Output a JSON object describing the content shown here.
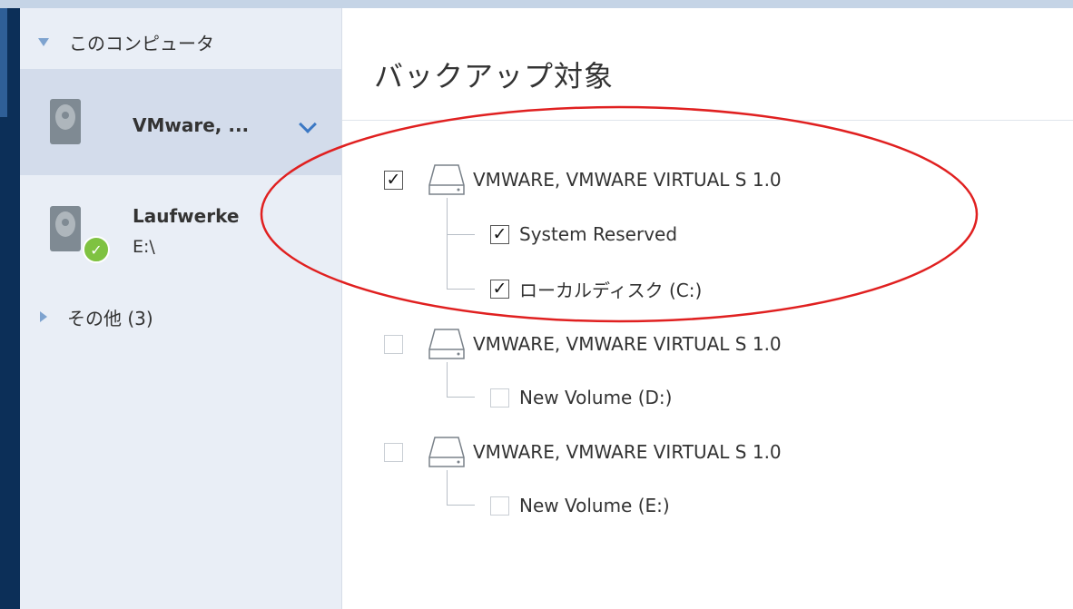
{
  "sidebar": {
    "group_computer": "このコンピュータ",
    "items": [
      {
        "title": "VMware, ...",
        "subtitle": ""
      },
      {
        "title": "Laufwerke",
        "subtitle": "E:\\"
      }
    ],
    "group_other": "その他 (3)"
  },
  "main": {
    "title": "バックアップ対象",
    "disks": [
      {
        "label": "VMWARE, VMWARE VIRTUAL S 1.0",
        "checked": true,
        "volumes": [
          {
            "label": "System Reserved",
            "checked": true
          },
          {
            "label": "ローカルディスク (C:)",
            "checked": true
          }
        ]
      },
      {
        "label": "VMWARE, VMWARE VIRTUAL S 1.0",
        "checked": false,
        "volumes": [
          {
            "label": "New Volume (D:)",
            "checked": false
          }
        ]
      },
      {
        "label": "VMWARE, VMWARE VIRTUAL S 1.0",
        "checked": false,
        "volumes": [
          {
            "label": "New Volume (E:)",
            "checked": false
          }
        ]
      }
    ]
  },
  "icons": [
    "chevron-down-icon",
    "hard-drive-icon",
    "check-badge-icon",
    "disk-icon",
    "checkmark-icon",
    "triangle-down-icon",
    "triangle-right-icon"
  ],
  "colors": {
    "sidebar_bg": "#e9eef6",
    "sidebar_selected": "#d3dceb",
    "left_strip": "#0c2f58",
    "accent_blue": "#3b78c4",
    "ok_green": "#7fc241",
    "highlight_ellipse": "#e02020"
  }
}
